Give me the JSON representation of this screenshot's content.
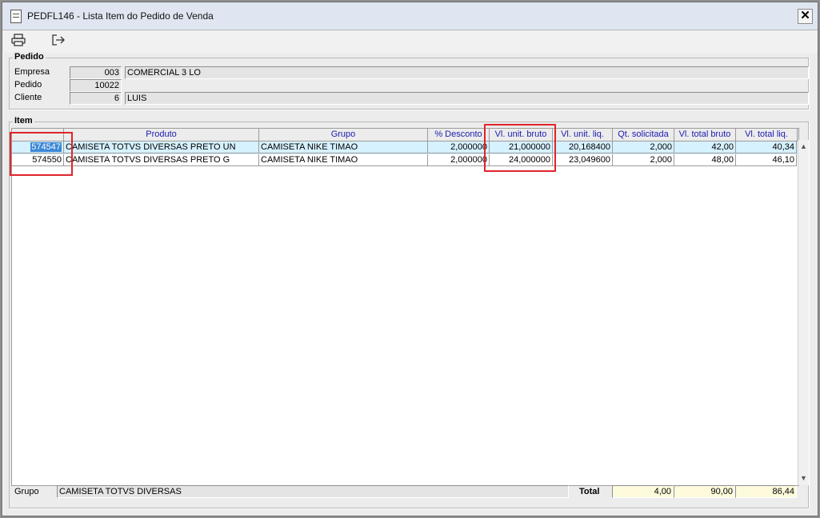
{
  "window": {
    "title": "PEDFL146 - Lista Item do Pedido de Venda"
  },
  "toolbar": {
    "print_icon": "printer-icon",
    "exit_icon": "exit-icon"
  },
  "pedido": {
    "group_title": "Pedido",
    "empresa_label": "Empresa",
    "empresa_code": "003",
    "empresa_name": "COMERCIAL 3 LO",
    "pedido_label": "Pedido",
    "pedido_number": "10022",
    "cliente_label": "Cliente",
    "cliente_code": "6",
    "cliente_name": "LUIS"
  },
  "item": {
    "group_title": "Item",
    "columns": [
      "",
      "Produto",
      "Grupo",
      "% Desconto",
      "Vl. unit. bruto",
      "Vl. unit. liq.",
      "Qt. solicitada",
      "Vl. total bruto",
      "Vl. total liq."
    ],
    "rows": [
      {
        "code": "574547",
        "produto": "CAMISETA TOTVS DIVERSAS PRETO UN",
        "grupo": "CAMISETA NIKE TIMAO",
        "desconto": "2,000000",
        "unit_bruto": "21,000000",
        "unit_liq": "20,168400",
        "qt": "2,000",
        "total_bruto": "42,00",
        "total_liq": "40,34"
      },
      {
        "code": "574550",
        "produto": "CAMISETA TOTVS DIVERSAS PRETO G",
        "grupo": "CAMISETA NIKE TIMAO",
        "desconto": "2,000000",
        "unit_bruto": "24,000000",
        "unit_liq": "23,049600",
        "qt": "2,000",
        "total_bruto": "48,00",
        "total_liq": "46,10"
      }
    ]
  },
  "footer": {
    "grupo_label": "Grupo",
    "grupo_value": "CAMISETA TOTVS DIVERSAS",
    "total_label": "Total",
    "total_qt": "4,00",
    "total_bruto": "90,00",
    "total_liq": "86,44"
  },
  "colors": {
    "highlight_box": "#e0242c",
    "selected_row": "#d6f1ff",
    "header_text": "#1b1bb0"
  }
}
